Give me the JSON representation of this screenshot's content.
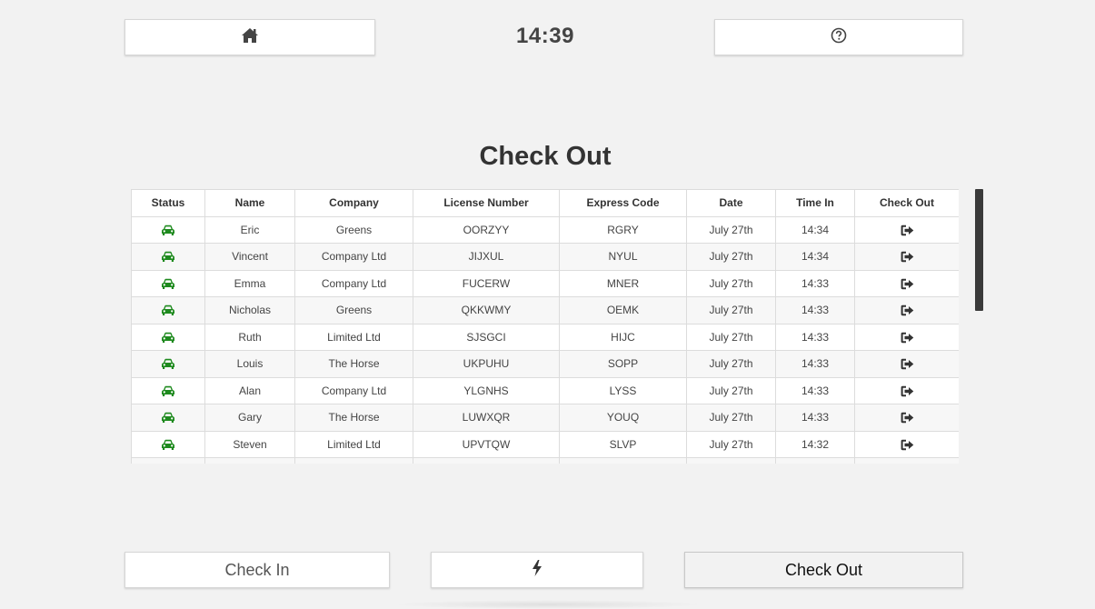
{
  "header": {
    "clock": "14:39",
    "home_icon": "home-icon",
    "help_icon": "question-circle-icon"
  },
  "page": {
    "title": "Check Out"
  },
  "table": {
    "columns": [
      "Status",
      "Name",
      "Company",
      "License Number",
      "Express Code",
      "Date",
      "Time In",
      "Check Out"
    ],
    "status_icon": "car-icon",
    "status_color": "#1e8a1e",
    "checkout_icon": "sign-out-icon",
    "rows": [
      {
        "name": "Eric",
        "company": "Greens",
        "license": "OORZYY",
        "code": "RGRY",
        "date": "July 27th",
        "time": "14:34"
      },
      {
        "name": "Vincent",
        "company": "Company Ltd",
        "license": "JIJXUL",
        "code": "NYUL",
        "date": "July 27th",
        "time": "14:34"
      },
      {
        "name": "Emma",
        "company": "Company Ltd",
        "license": "FUCERW",
        "code": "MNER",
        "date": "July 27th",
        "time": "14:33"
      },
      {
        "name": "Nicholas",
        "company": "Greens",
        "license": "QKKWMY",
        "code": "OEMK",
        "date": "July 27th",
        "time": "14:33"
      },
      {
        "name": "Ruth",
        "company": "Limited Ltd",
        "license": "SJSGCI",
        "code": "HIJC",
        "date": "July 27th",
        "time": "14:33"
      },
      {
        "name": "Louis",
        "company": "The Horse",
        "license": "UKPUHU",
        "code": "SOPP",
        "date": "July 27th",
        "time": "14:33"
      },
      {
        "name": "Alan",
        "company": "Company Ltd",
        "license": "YLGNHS",
        "code": "LYSS",
        "date": "July 27th",
        "time": "14:33"
      },
      {
        "name": "Gary",
        "company": "The Horse",
        "license": "LUWXQR",
        "code": "YOUQ",
        "date": "July 27th",
        "time": "14:33"
      },
      {
        "name": "Steven",
        "company": "Limited Ltd",
        "license": "UPVTQW",
        "code": "SLVP",
        "date": "July 27th",
        "time": "14:32"
      },
      {
        "name": "",
        "company": "",
        "license": "",
        "code": "",
        "date": "",
        "time": ""
      }
    ]
  },
  "footer": {
    "checkin_label": "Check In",
    "lightning_icon": "lightning-bolt-icon",
    "checkout_label": "Check Out"
  }
}
